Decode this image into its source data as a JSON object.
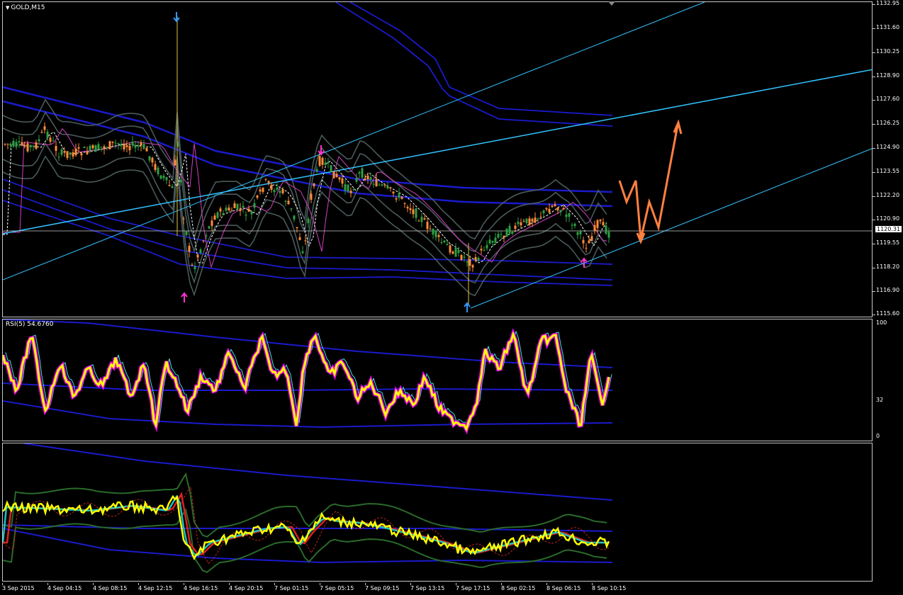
{
  "chart": {
    "symbol_label": "GOLD,M15",
    "rsi_label": "RSI(5) 54.6760",
    "current_price": "1120.31",
    "price_ticks": [
      "1132.95",
      "1131.60",
      "1130.25",
      "1128.90",
      "1127.60",
      "1126.25",
      "1124.90",
      "1123.55",
      "1122.20",
      "1120.90",
      "1119.55",
      "1118.20",
      "1116.90",
      "1115.60"
    ],
    "rsi_ticks": [
      "100",
      "32",
      "0"
    ],
    "time_ticks": [
      "3 Sep 2015",
      "4 Sep 04:15",
      "4 Sep 08:15",
      "4 Sep 12:15",
      "4 Sep 16:15",
      "4 Sep 20:15",
      "7 Sep 01:15",
      "7 Sep 05:15",
      "7 Sep 09:15",
      "7 Sep 13:15",
      "7 Sep 17:15",
      "8 Sep 02:15",
      "8 Sep 06:15",
      "8 Sep 10:15"
    ],
    "colors": {
      "background": "#000000",
      "bull_candle": "#2ea043",
      "bear_candle": "#ff8c3a",
      "channel": "#33c3ff",
      "envelope": "#1a1acc",
      "bands": "#4a5a5a",
      "rsi_main": "#ffff00",
      "rsi_glow": "#ff00ff",
      "forecast": "#ff8040",
      "arrow_down": "#3399ff",
      "arrow_up_magenta": "#ff33cc"
    }
  }
}
